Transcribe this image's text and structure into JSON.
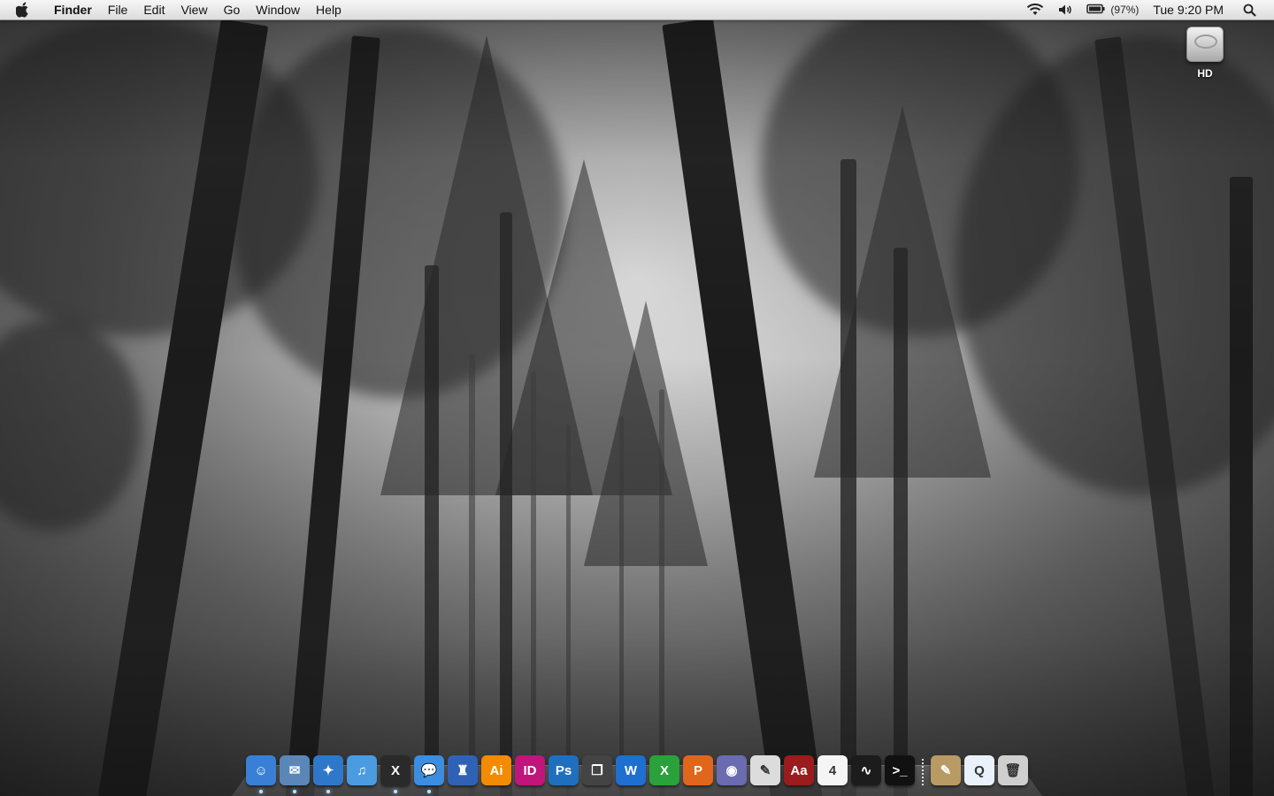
{
  "menubar": {
    "apple": "apple-menu",
    "items": [
      {
        "label": "Finder",
        "bold": true
      },
      {
        "label": "File"
      },
      {
        "label": "Edit"
      },
      {
        "label": "View"
      },
      {
        "label": "Go"
      },
      {
        "label": "Window"
      },
      {
        "label": "Help"
      }
    ],
    "status": {
      "wifi_icon": "wifi-icon",
      "volume_icon": "volume-icon",
      "battery_icon": "battery-icon",
      "battery_percent": "(97%)",
      "clock": "Tue 9:20 PM",
      "spotlight_icon": "spotlight-icon"
    }
  },
  "desktop": {
    "icons": [
      {
        "label": "HD",
        "icon": "hard-drive-icon"
      }
    ]
  },
  "dock": {
    "items": [
      {
        "name": "finder",
        "icon": "finder-icon",
        "glyph": "☺",
        "color": "#3a7fd6",
        "running": true
      },
      {
        "name": "mail",
        "icon": "mail-stamp-icon",
        "glyph": "✉",
        "color": "#5b86b8",
        "running": true
      },
      {
        "name": "safari",
        "icon": "safari-compass-icon",
        "glyph": "✦",
        "color": "#2f78c9",
        "running": true
      },
      {
        "name": "itunes",
        "icon": "itunes-icon",
        "glyph": "♫",
        "color": "#4a9be0",
        "running": false
      },
      {
        "name": "codex",
        "icon": "codex-icon",
        "glyph": "X",
        "color": "#2a2a2a",
        "running": true
      },
      {
        "name": "ichat",
        "icon": "ichat-bubble-icon",
        "glyph": "💬",
        "color": "#3c8de0",
        "running": true
      },
      {
        "name": "cyberduck",
        "icon": "wizard-figure-icon",
        "glyph": "♜",
        "color": "#2f62b5",
        "running": false
      },
      {
        "name": "illustrator",
        "icon": "illustrator-icon",
        "glyph": "Ai",
        "color": "#f28b00",
        "running": false
      },
      {
        "name": "indesign",
        "icon": "indesign-icon",
        "glyph": "ID",
        "color": "#c0157b",
        "running": false
      },
      {
        "name": "photoshop",
        "icon": "photoshop-icon",
        "glyph": "Ps",
        "color": "#1f6fbf",
        "running": false
      },
      {
        "name": "vmware",
        "icon": "overlapping-squares-icon",
        "glyph": "❐",
        "color": "#444",
        "running": false
      },
      {
        "name": "word",
        "icon": "word-icon",
        "glyph": "W",
        "color": "#1e6fd0",
        "running": false
      },
      {
        "name": "excel",
        "icon": "excel-icon",
        "glyph": "X",
        "color": "#2aa13b",
        "running": false
      },
      {
        "name": "powerpoint",
        "icon": "powerpoint-icon",
        "glyph": "P",
        "color": "#e0661b",
        "running": false
      },
      {
        "name": "linux",
        "icon": "tux-badge-icon",
        "glyph": "◉",
        "color": "#6b6bb0",
        "running": false
      },
      {
        "name": "textedit",
        "icon": "document-pen-icon",
        "glyph": "✎",
        "color": "#dcdcdc",
        "running": false
      },
      {
        "name": "dictionary",
        "icon": "dictionary-icon",
        "glyph": "Aa",
        "color": "#9b1c1c",
        "running": false
      },
      {
        "name": "ical",
        "icon": "calendar-icon",
        "glyph": "4",
        "color": "#f5f5f5",
        "running": false
      },
      {
        "name": "activity-monitor",
        "icon": "activity-monitor-icon",
        "glyph": "∿",
        "color": "#1c1c1c",
        "running": false
      },
      {
        "name": "terminal",
        "icon": "terminal-icon",
        "glyph": ">_",
        "color": "#111",
        "running": false
      }
    ],
    "right_items": [
      {
        "name": "downloads",
        "icon": "scroll-document-icon",
        "glyph": "✎",
        "color": "#b89a64"
      },
      {
        "name": "movie",
        "icon": "movie-file-icon",
        "glyph": "Q",
        "color": "#e9f2fb"
      },
      {
        "name": "trash",
        "icon": "trash-icon",
        "glyph": "🗑",
        "color": "#cfcfcf"
      }
    ]
  }
}
